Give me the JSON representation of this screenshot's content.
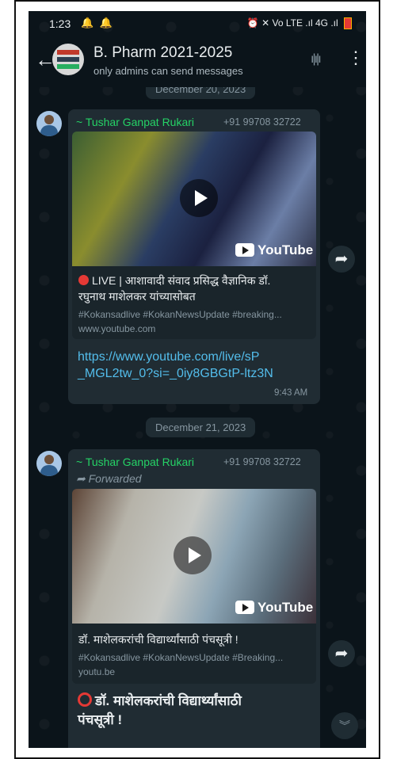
{
  "status_bar": {
    "time": "1:23",
    "notification_icons": "🔔 🔔",
    "right_icons": "⏰ ✕ Vo LTE .ıl 4G .ıl"
  },
  "header": {
    "back_icon": "arrow-left-icon",
    "title": "B. Pharm 2021-2025",
    "subtitle": "only admins can send messages"
  },
  "dates": {
    "top": "December 20, 2023",
    "middle": "December 21, 2023"
  },
  "messages": [
    {
      "sender": "~ Tushar Ganpat Rukari",
      "phone": "+91 99708 32722",
      "preview": {
        "brand": "YouTube",
        "title_line1": "LIVE | आशावादी संवाद प्रसिद्ध वैज्ञानिक डॉ.",
        "title_line2": "रघुनाथ माशेलकर यांच्यासोबत",
        "desc": "#Kokansadlive #KokanNewsUpdate #breaking...",
        "domain": "www.youtube.com"
      },
      "link_line1": "https://www.youtube.com/live/sP",
      "link_line2": "_MGL2tw_0?si=_0iy8GBGtP-ltz3N",
      "time": "9:43 AM"
    },
    {
      "sender": "~ Tushar Ganpat Rukari",
      "phone": "+91 99708 32722",
      "forwarded": "Forwarded",
      "preview": {
        "brand": "YouTube",
        "title_line1": "डॉ. माशेलकरांची विद्यार्थ्यांसाठी पंचसूत्री !",
        "desc": "#Kokansadlive #KokanNewsUpdate #Breaking...",
        "domain": "youtu.be"
      },
      "text_line1": "डॉ. माशेलकरांची विद्यार्थ्यांसाठी",
      "text_line2": "पंचसूत्री !"
    }
  ],
  "icons": {
    "share": "share-arrow-icon",
    "scroll_down": "chevrons-down-icon",
    "play": "play-icon"
  },
  "colors": {
    "background": "#0b141a",
    "bubble": "#202c33",
    "sender": "#25d366",
    "link": "#53bdeb"
  }
}
